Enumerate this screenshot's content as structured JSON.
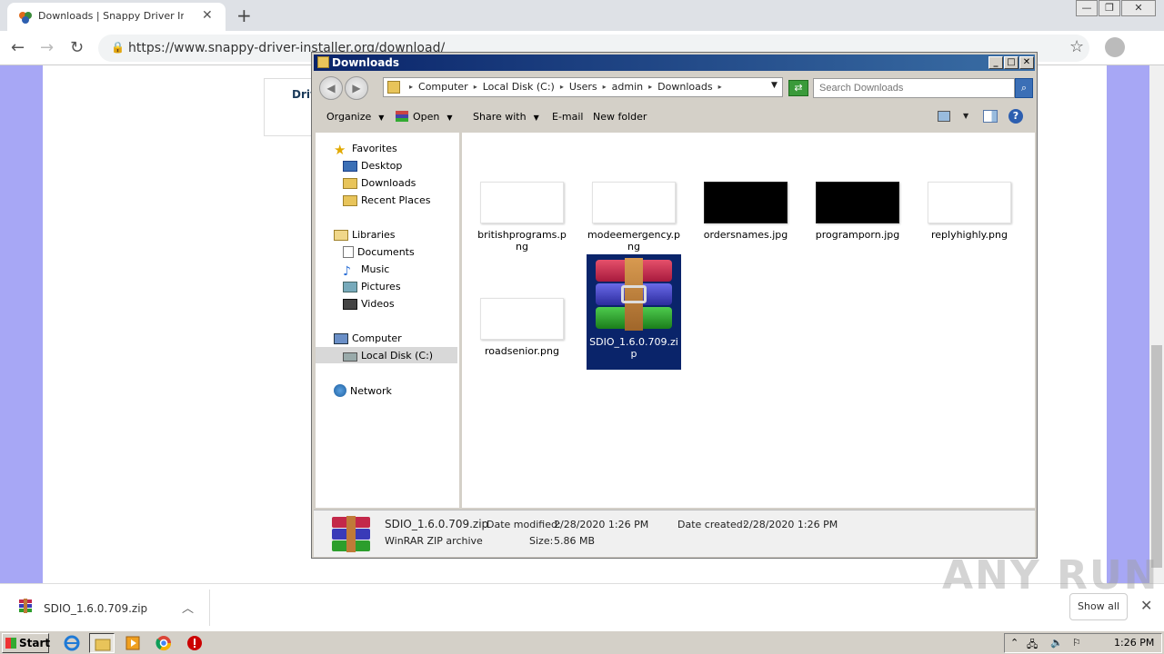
{
  "browser": {
    "tab_title": "Downloads | Snappy Driver Installer",
    "tab_close": "✕",
    "new_tab": "+",
    "url": "https://www.snappy-driver-installer.org/download/",
    "win_minimize": "—",
    "win_restore": "❐",
    "win_close": "✕"
  },
  "webpage": {
    "partial_tab_label": "Driv"
  },
  "explorer": {
    "title": "Downloads",
    "breadcrumb": [
      "Computer",
      "Local Disk (C:)",
      "Users",
      "admin",
      "Downloads"
    ],
    "search_placeholder": "Search Downloads",
    "toolbar": {
      "organize": "Organize",
      "open": "Open",
      "share_with": "Share with",
      "email": "E-mail",
      "new_folder": "New folder"
    },
    "nav": {
      "favorites": "Favorites",
      "desktop": "Desktop",
      "downloads": "Downloads",
      "recent_places": "Recent Places",
      "libraries": "Libraries",
      "documents": "Documents",
      "music": "Music",
      "pictures": "Pictures",
      "videos": "Videos",
      "computer": "Computer",
      "local_disk": "Local Disk (C:)",
      "network": "Network"
    },
    "files": [
      {
        "name": "britishprograms.png",
        "thumb": "light"
      },
      {
        "name": "modeemergency.png",
        "thumb": "light"
      },
      {
        "name": "ordersnames.jpg",
        "thumb": "dark"
      },
      {
        "name": "programporn.jpg",
        "thumb": "dark"
      },
      {
        "name": "replyhighly.png",
        "thumb": "light"
      },
      {
        "name": "roadsenior.png",
        "thumb": "light"
      },
      {
        "name": "SDIO_1.6.0.709.zip",
        "thumb": "rar",
        "selected": true
      }
    ],
    "details": {
      "filename": "SDIO_1.6.0.709.zip",
      "type": "WinRAR ZIP archive",
      "date_modified_label": "Date modified:",
      "date_modified": "2/28/2020 1:26 PM",
      "date_created_label": "Date created:",
      "date_created": "2/28/2020 1:26 PM",
      "size_label": "Size:",
      "size": "5.86 MB"
    }
  },
  "download_shelf": {
    "item_name": "SDIO_1.6.0.709.zip",
    "show_all": "Show all"
  },
  "watermark": "ANY RUN",
  "taskbar": {
    "start": "Start",
    "clock": "1:26 PM"
  }
}
